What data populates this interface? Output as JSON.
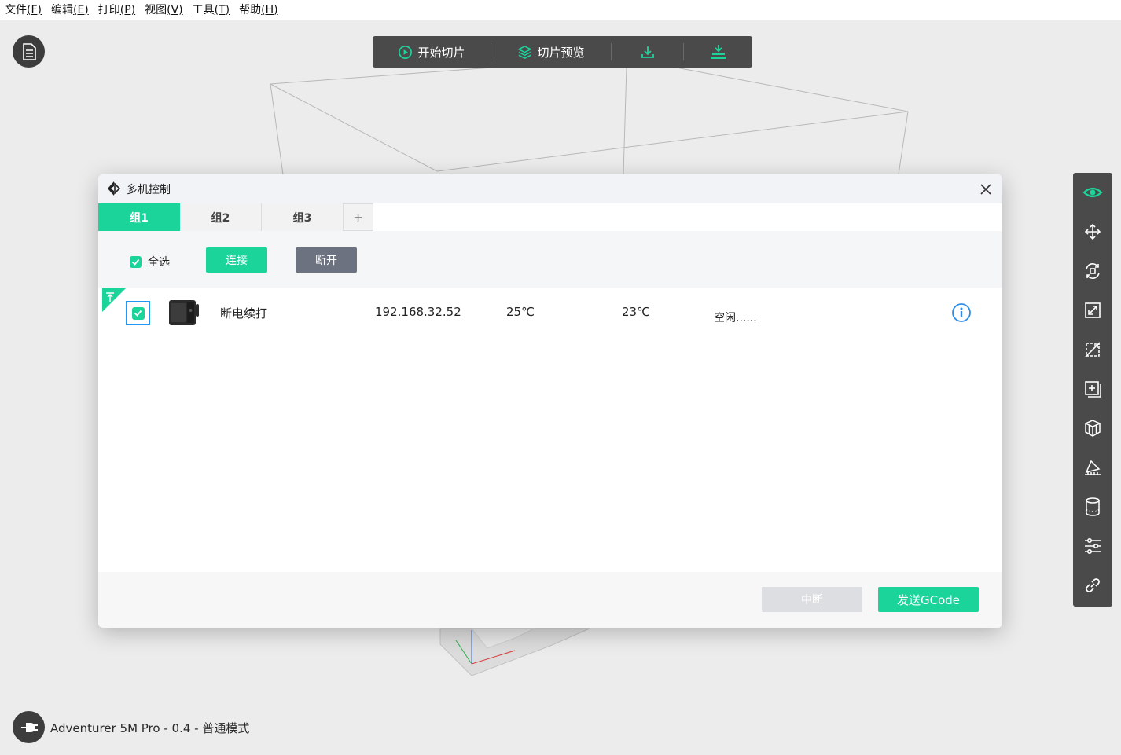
{
  "menu": {
    "items": [
      {
        "label": "文件",
        "accel": "(F)"
      },
      {
        "label": "编辑",
        "accel": "(E)"
      },
      {
        "label": "打印",
        "accel": "(P)"
      },
      {
        "label": "视图",
        "accel": "(V)"
      },
      {
        "label": "工具",
        "accel": "(T)"
      },
      {
        "label": "帮助",
        "accel": "(H)"
      }
    ]
  },
  "toolbar": {
    "start_slice": "开始切片",
    "slice_preview": "切片预览"
  },
  "printer_info": {
    "label": "Adventurer 5M Pro - 0.4 - 普通模式"
  },
  "dialog": {
    "title": "多机控制",
    "tabs": [
      {
        "label": "组1",
        "active": true
      },
      {
        "label": "组2",
        "active": false
      },
      {
        "label": "组3",
        "active": false
      }
    ],
    "add_tab": "+",
    "select_all": "全选",
    "connect": "连接",
    "disconnect": "断开",
    "devices": [
      {
        "name": "断电续打",
        "ip": "192.168.32.52",
        "nozzle_temp": "25℃",
        "bed_temp": "23℃",
        "status": "空闲......"
      }
    ],
    "abort": "中断",
    "send_gcode": "发送GCode"
  },
  "colors": {
    "accent": "#1ad49a",
    "toolbar_bg": "#4a4a4a",
    "disconnect_bg": "#6c7280",
    "info_blue": "#2f8de4"
  },
  "icons": {
    "right_toolbar": [
      "eye-icon",
      "move-icon",
      "rotate-icon",
      "scale-icon",
      "mirror-icon",
      "add-model-icon",
      "auto-arrange-icon",
      "lay-flat-icon",
      "cylinder-icon",
      "settings-sliders-icon",
      "link-icon"
    ]
  }
}
